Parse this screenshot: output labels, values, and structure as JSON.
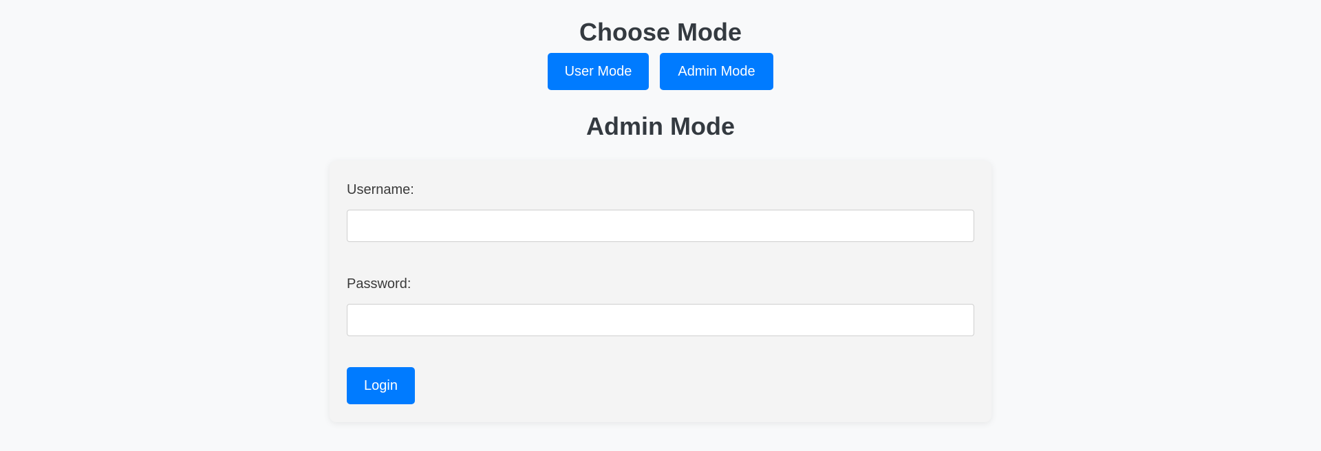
{
  "header": {
    "title": "Choose Mode"
  },
  "mode_buttons": {
    "user_label": "User Mode",
    "admin_label": "Admin Mode"
  },
  "section": {
    "title": "Admin Mode"
  },
  "login_form": {
    "username_label": "Username:",
    "username_value": "",
    "password_label": "Password:",
    "password_value": "",
    "submit_label": "Login"
  },
  "colors": {
    "accent": "#007bff",
    "background": "#f8f9fa",
    "card_background": "#f4f4f4",
    "heading_text": "#343a40"
  }
}
